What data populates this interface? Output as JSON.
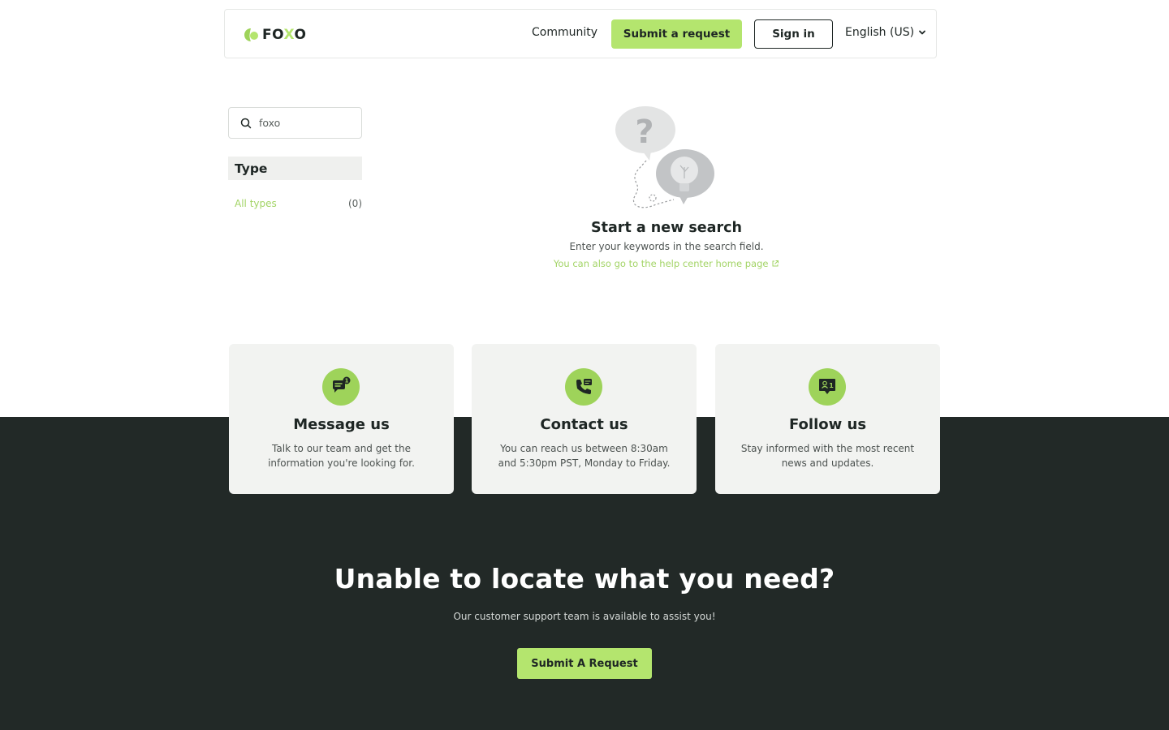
{
  "header": {
    "logo_text_pre": "FO",
    "logo_text_x": "X",
    "logo_text_post": "O",
    "nav_community": "Community",
    "submit_request": "Submit a request",
    "sign_in": "Sign in",
    "language": "English (US)"
  },
  "sidebar": {
    "search_value": "foxo",
    "type_heading": "Type",
    "filters": [
      {
        "label": "All types",
        "count": "(0)"
      }
    ]
  },
  "empty_state": {
    "title": "Start a new search",
    "subtitle": "Enter your keywords in the search field.",
    "link": "You can also go to the help center home page"
  },
  "cards": [
    {
      "icon": "message-icon",
      "title": "Message us",
      "text": "Talk to our team and get the information you're looking for."
    },
    {
      "icon": "phone-icon",
      "title": "Contact us",
      "text": "You can reach us between 8:30am and 5:30pm PST, Monday to Friday."
    },
    {
      "icon": "follow-icon",
      "title": "Follow us",
      "text": "Stay informed with the most recent news and updates."
    }
  ],
  "cta": {
    "title": "Unable to locate what you need?",
    "subtitle": "Our customer support team is available to assist you!",
    "button": "Submit A Request"
  },
  "colors": {
    "accent": "#b4e56e",
    "dark": "#222927",
    "card_bg": "#f2f3f1"
  }
}
